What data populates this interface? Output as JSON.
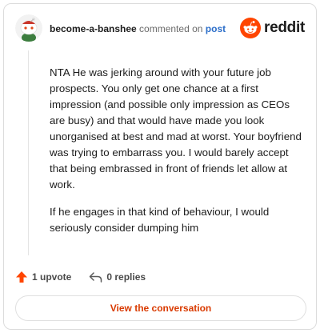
{
  "comment": {
    "username": "become-a-banshee",
    "verb": "commented on",
    "post_link": "post",
    "paragraphs": [
      "NTA He was jerking around with your future job prospects. You only get one chance at a first impression (and possible only impression as CEOs are busy) and that would have made you look unorganised at best and mad at worst. Your boyfriend was trying to embarrass you. I would barely accept that being embrassed in front of friends let allow at work.",
      "If he engages in that kind of behaviour, I would seriously consider dumping him"
    ],
    "upvotes": "1 upvote",
    "replies": "0 replies"
  },
  "brand": {
    "wordmark": "reddit",
    "color": "#ff4500"
  },
  "cta": {
    "label": "View the conversation"
  }
}
